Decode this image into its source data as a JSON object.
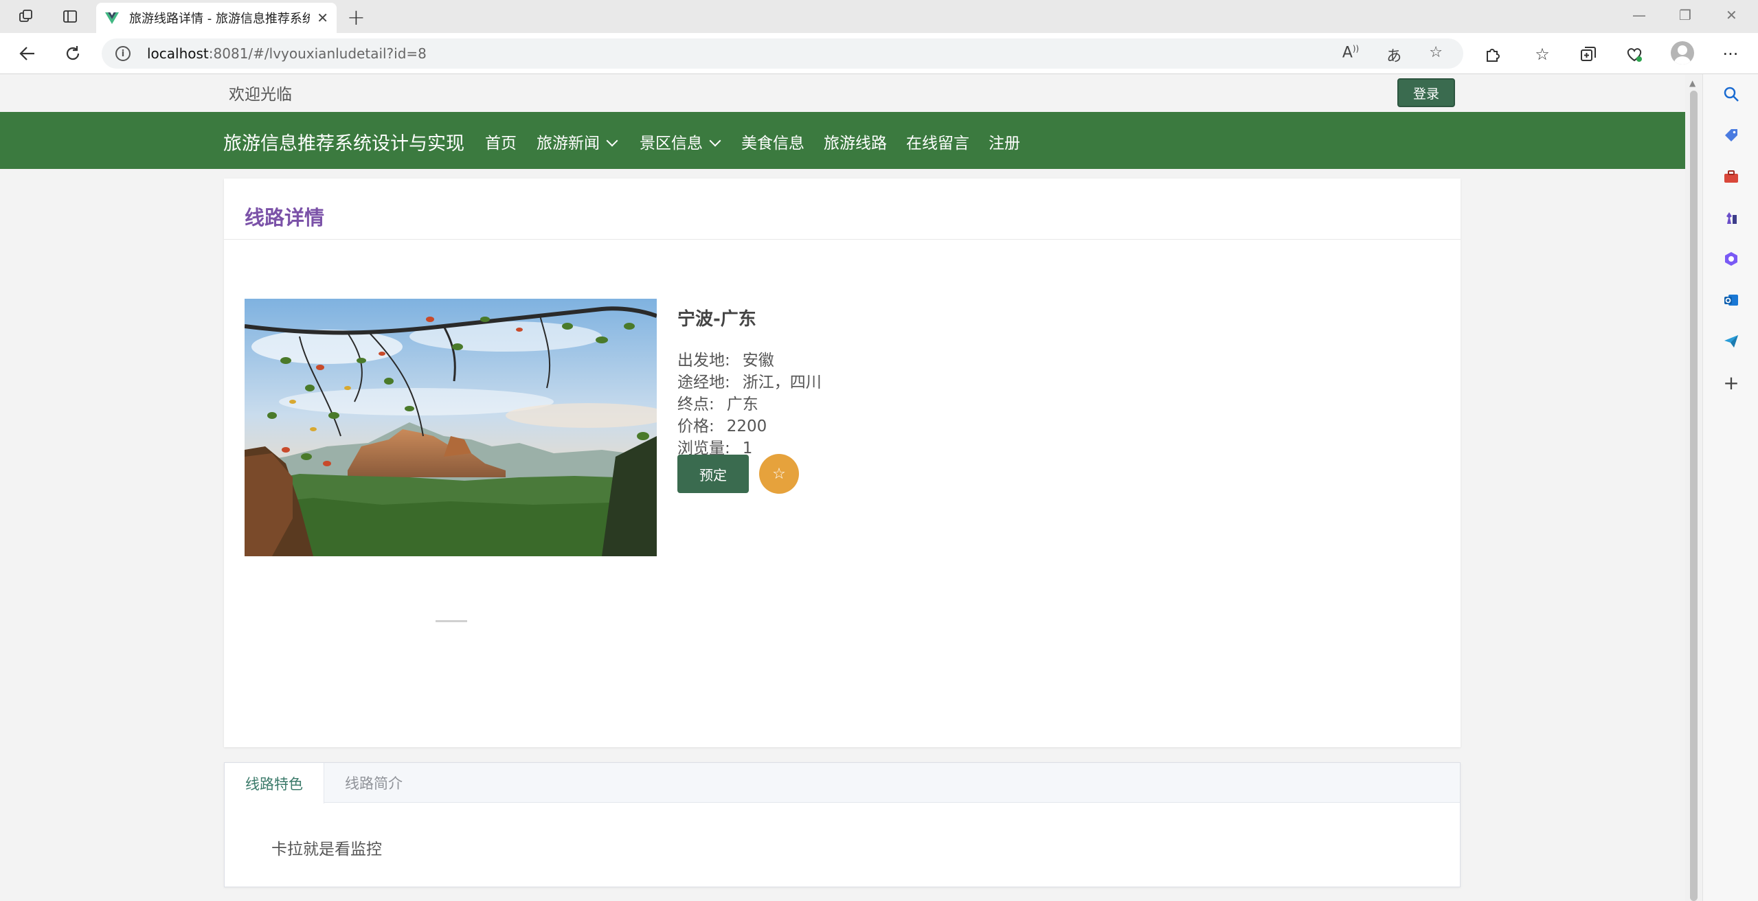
{
  "browser": {
    "tab_title": "旅游线路详情 - 旅游信息推荐系统设计与实现",
    "url_host": "localhost",
    "url_path": ":8081/#/lvyouxianludetail?id=8",
    "new_tab": "+",
    "close_tab": "✕",
    "minimize": "—",
    "restore": "❐",
    "close_window": "✕",
    "more": "···"
  },
  "header": {
    "welcome": "欢迎光临",
    "login_label": "登录"
  },
  "nav": {
    "site_title": "旅游信息推荐系统设计与实现",
    "items": [
      {
        "label": "首页"
      },
      {
        "label": "旅游新闻"
      },
      {
        "label": "景区信息"
      },
      {
        "label": "美食信息"
      },
      {
        "label": "旅游线路"
      },
      {
        "label": "在线留言"
      },
      {
        "label": "注册"
      }
    ]
  },
  "detail": {
    "section_title": "线路详情",
    "route_name": "宁波-广东",
    "fields": [
      {
        "label": "出发地:",
        "value": "安徽"
      },
      {
        "label": "途经地:",
        "value": "浙江，四川"
      },
      {
        "label": "终点:",
        "value": "广东"
      },
      {
        "label": "价格:",
        "value": "2200"
      },
      {
        "label": "浏览量:",
        "value": "1"
      }
    ],
    "book_label": "预定",
    "fav_icon": "☆"
  },
  "tabs": {
    "items": [
      {
        "label": "线路特色"
      },
      {
        "label": "线路简介"
      }
    ],
    "content": "卡拉就是看监控"
  },
  "colors": {
    "nav_bg": "#3b7a3f",
    "button_green": "#3a6b4f",
    "title_purple": "#7b52a8",
    "fav_orange": "#e6a23c",
    "tab_active": "#3b7a6a"
  }
}
